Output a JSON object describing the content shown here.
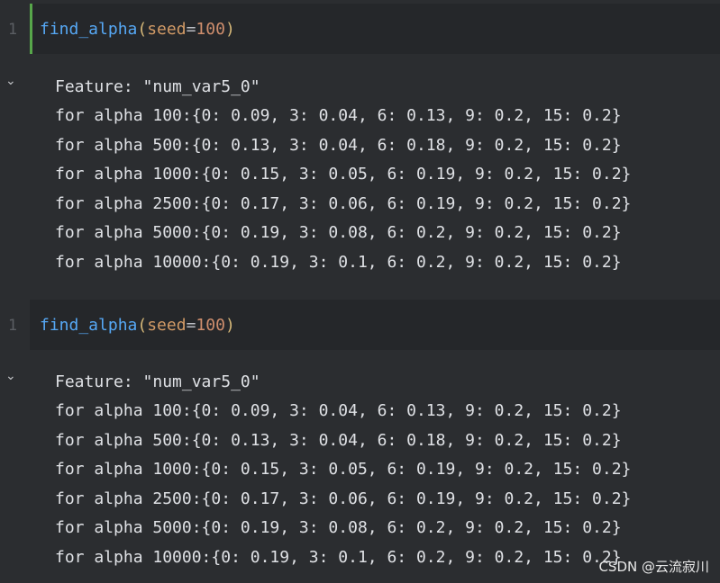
{
  "cells": [
    {
      "line_number": "1",
      "code": {
        "fn": "find_alpha",
        "open": "(",
        "param": "seed",
        "eq": "=",
        "num": "100",
        "close": ")"
      },
      "output": {
        "feature_line": "Feature: \"num_var5_0\"",
        "lines": [
          "for alpha 100:{0: 0.09, 3: 0.04, 6: 0.13, 9: 0.2, 15: 0.2}",
          "for alpha 500:{0: 0.13, 3: 0.04, 6: 0.18, 9: 0.2, 15: 0.2}",
          "for alpha 1000:{0: 0.15, 3: 0.05, 6: 0.19, 9: 0.2, 15: 0.2}",
          "for alpha 2500:{0: 0.17, 3: 0.06, 6: 0.19, 9: 0.2, 15: 0.2}",
          "for alpha 5000:{0: 0.19, 3: 0.08, 6: 0.2, 9: 0.2, 15: 0.2}",
          "for alpha 10000:{0: 0.19, 3: 0.1, 6: 0.2, 9: 0.2, 15: 0.2}"
        ]
      }
    },
    {
      "line_number": "1",
      "code": {
        "fn": "find_alpha",
        "open": "(",
        "param": "seed",
        "eq": "=",
        "num": "100",
        "close": ")"
      },
      "output": {
        "feature_line": "Feature: \"num_var5_0\"",
        "lines": [
          "for alpha 100:{0: 0.09, 3: 0.04, 6: 0.13, 9: 0.2, 15: 0.2}",
          "for alpha 500:{0: 0.13, 3: 0.04, 6: 0.18, 9: 0.2, 15: 0.2}",
          "for alpha 1000:{0: 0.15, 3: 0.05, 6: 0.19, 9: 0.2, 15: 0.2}",
          "for alpha 2500:{0: 0.17, 3: 0.06, 6: 0.19, 9: 0.2, 15: 0.2}",
          "for alpha 5000:{0: 0.19, 3: 0.08, 6: 0.2, 9: 0.2, 15: 0.2}",
          "for alpha 10000:{0: 0.19, 3: 0.1, 6: 0.2, 9: 0.2, 15: 0.2}"
        ]
      }
    }
  ],
  "icons": {
    "collapse": "chevron-down-icon"
  },
  "watermark": "CSDN @云流寂川"
}
